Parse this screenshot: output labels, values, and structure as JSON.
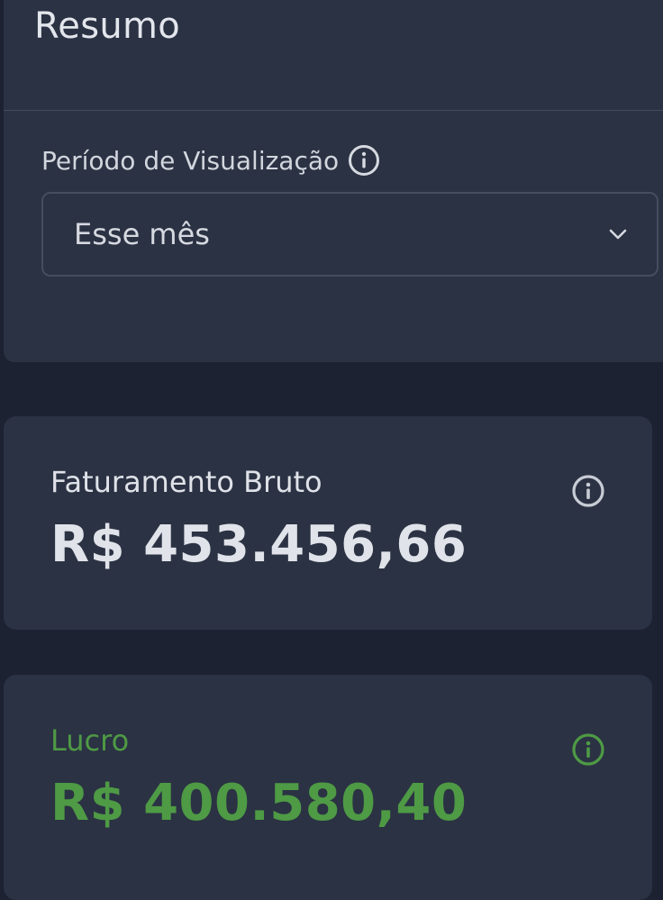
{
  "summary": {
    "title": "Resumo",
    "period_label": "Período de Visualização",
    "period_info_icon": "info-icon",
    "period_select": {
      "value": "Esse mês",
      "icon": "chevron-down-icon"
    }
  },
  "cards": {
    "revenue": {
      "label": "Faturamento Bruto",
      "value": "R$ 453.456,66",
      "icon": "info-icon",
      "color": "#e0e3e9"
    },
    "profit": {
      "label": "Lucro",
      "value": "R$ 400.580,40",
      "icon": "info-icon",
      "color": "#4e9a45"
    }
  },
  "colors": {
    "background": "#1c2232",
    "panel": "#2b3243",
    "accent_green": "#4e9a45"
  }
}
